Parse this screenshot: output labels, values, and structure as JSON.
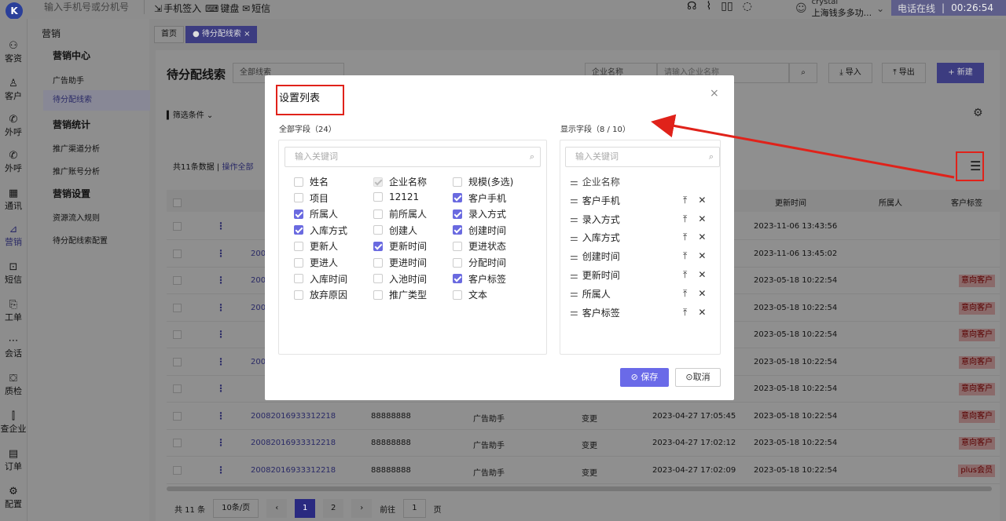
{
  "topbar": {
    "logo": "K",
    "phone_placeholder": "输入手机号或分机号",
    "items": [
      "手机签入",
      "键盘",
      "短信"
    ],
    "user_name": "crystal",
    "company": "上海钱多多功...",
    "status": "电话在线",
    "timer": "00:26:54"
  },
  "leftnav": [
    "客资",
    "客户",
    "外呼",
    "外呼",
    "通讯",
    "营销",
    "短信",
    "工单",
    "会话",
    "质检",
    "查企业",
    "订单",
    "配置"
  ],
  "subnav": {
    "header": "营销",
    "groups": [
      "营销中心",
      "营销统计",
      "营销设置"
    ],
    "items": [
      "广告助手",
      "待分配线索",
      "推广渠道分析",
      "推广账号分析",
      "资源流入规则",
      "待分配线索配置"
    ]
  },
  "tabs": [
    "首页",
    "待分配线索"
  ],
  "page": {
    "title": "待分配线索",
    "select_all": "全部线索",
    "company_select": "企业名称",
    "company_placeholder": "请输入企业名称",
    "import": "导入",
    "export": "导出",
    "new": "新建",
    "filter": "筛选条件",
    "total": "共11条数据",
    "op_all": "操作全部"
  },
  "table": {
    "headers": [
      "更新时间",
      "所属人",
      "客户标签"
    ],
    "rows": [
      {
        "id": "",
        "phone": "",
        "source": "",
        "method": "",
        "created": "",
        "updated": "2023-11-06 13:43:56",
        "tag": ""
      },
      {
        "id": "2008",
        "phone": "",
        "source": "",
        "method": "",
        "created": "",
        "updated": "2023-11-06 13:45:02",
        "tag": ""
      },
      {
        "id": "2008",
        "phone": "",
        "source": "",
        "method": "",
        "created": "",
        "updated": "2023-05-18 10:22:54",
        "tag": "意向客户"
      },
      {
        "id": "2008",
        "phone": "",
        "source": "",
        "method": "",
        "created": "",
        "updated": "2023-05-18 10:22:54",
        "tag": "意向客户"
      },
      {
        "id": "",
        "phone": "",
        "source": "",
        "method": "",
        "created": "",
        "updated": "2023-05-18 10:22:54",
        "tag": "意向客户"
      },
      {
        "id": "2008",
        "phone": "",
        "source": "",
        "method": "",
        "created": "",
        "updated": "2023-05-18 10:22:54",
        "tag": "意向客户"
      },
      {
        "id": "",
        "phone": "",
        "source": "",
        "method": "",
        "created": "",
        "updated": "2023-05-18 10:22:54",
        "tag": "意向客户"
      },
      {
        "id": "20082016933312218",
        "phone": "88888888",
        "source": "广告助手",
        "method": "变更",
        "created": "2023-04-27 17:05:45",
        "updated": "2023-05-18 10:22:54",
        "tag": "意向客户"
      },
      {
        "id": "20082016933312218",
        "phone": "88888888",
        "source": "广告助手",
        "method": "变更",
        "created": "2023-04-27 17:02:12",
        "updated": "2023-05-18 10:22:54",
        "tag": "意向客户"
      },
      {
        "id": "20082016933312218",
        "phone": "88888888",
        "source": "广告助手",
        "method": "变更",
        "created": "2023-04-27 17:02:09",
        "updated": "2023-05-18 10:22:54",
        "tag": "plus会员"
      }
    ]
  },
  "pager": {
    "total": "共 11 条",
    "size": "10条/页",
    "pages": [
      "1",
      "2"
    ],
    "goto": "前往",
    "goto_value": "1",
    "page_unit": "页"
  },
  "modal": {
    "title": "设置列表",
    "all_fields": "全部字段（24）",
    "shown_fields": "显示字段（8 / 10）",
    "search_placeholder": "输入关键词",
    "fields": [
      {
        "label": "姓名",
        "state": "off"
      },
      {
        "label": "企业名称",
        "state": "dis"
      },
      {
        "label": "规模(多选)",
        "state": "off"
      },
      {
        "label": "项目",
        "state": "off"
      },
      {
        "label": "12121",
        "state": "off"
      },
      {
        "label": "客户手机",
        "state": "on"
      },
      {
        "label": "所属人",
        "state": "on"
      },
      {
        "label": "前所属人",
        "state": "off"
      },
      {
        "label": "录入方式",
        "state": "on"
      },
      {
        "label": "入库方式",
        "state": "on"
      },
      {
        "label": "创建人",
        "state": "off"
      },
      {
        "label": "创建时间",
        "state": "on"
      },
      {
        "label": "更新人",
        "state": "off"
      },
      {
        "label": "更新时间",
        "state": "on"
      },
      {
        "label": "更进状态",
        "state": "off"
      },
      {
        "label": "更进人",
        "state": "off"
      },
      {
        "label": "更进时间",
        "state": "off"
      },
      {
        "label": "分配时间",
        "state": "off"
      },
      {
        "label": "入库时间",
        "state": "off"
      },
      {
        "label": "入池时间",
        "state": "off"
      },
      {
        "label": "客户标签",
        "state": "on"
      },
      {
        "label": "放弃原因",
        "state": "off"
      },
      {
        "label": "推广类型",
        "state": "off"
      },
      {
        "label": "文本",
        "state": "off"
      }
    ],
    "shown": [
      "企业名称",
      "客户手机",
      "录入方式",
      "入库方式",
      "创建时间",
      "更新时间",
      "所属人",
      "客户标签"
    ],
    "save": "保存",
    "cancel": "取消"
  },
  "colors": {
    "accent": "#6a6ae8",
    "annotation": "#e0221a"
  }
}
